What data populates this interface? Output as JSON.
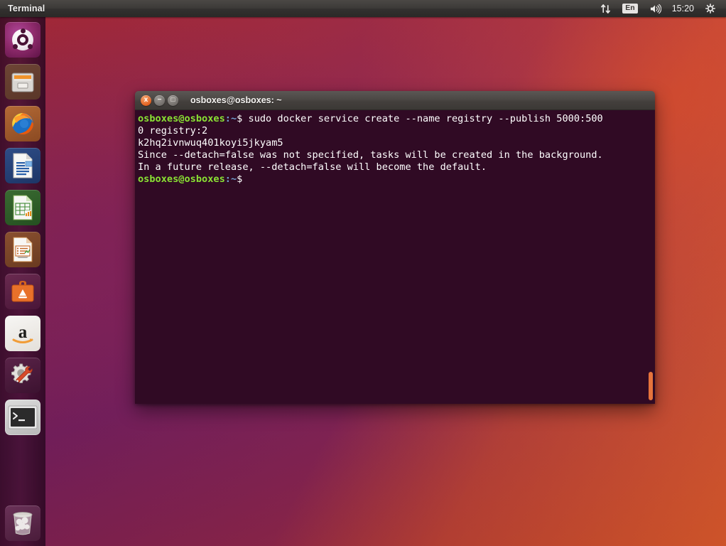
{
  "panel": {
    "app_title": "Terminal",
    "indicators": [
      {
        "name": "network-icon",
        "label": ""
      },
      {
        "name": "keyboard-layout-indicator",
        "label": "En"
      },
      {
        "name": "volume-icon",
        "label": ""
      },
      {
        "name": "clock",
        "label": "15:20"
      },
      {
        "name": "system-menu-icon",
        "label": ""
      }
    ],
    "clock": "15:20",
    "keyboard_layout": "En"
  },
  "launcher": {
    "items": [
      {
        "name": "ubuntu-dash",
        "label": "Ubuntu Dash Home",
        "running": false
      },
      {
        "name": "files",
        "label": "Files",
        "running": false
      },
      {
        "name": "firefox",
        "label": "Firefox Web Browser",
        "running": false
      },
      {
        "name": "libreoffice-writer",
        "label": "LibreOffice Writer",
        "running": false
      },
      {
        "name": "libreoffice-calc",
        "label": "LibreOffice Calc",
        "running": false
      },
      {
        "name": "libreoffice-impress",
        "label": "LibreOffice Impress",
        "running": false
      },
      {
        "name": "ubuntu-software",
        "label": "Ubuntu Software",
        "running": false
      },
      {
        "name": "amazon",
        "label": "Amazon",
        "running": false
      },
      {
        "name": "system-settings",
        "label": "System Settings",
        "running": false
      },
      {
        "name": "terminal",
        "label": "Terminal",
        "running": true
      },
      {
        "name": "trash",
        "label": "Trash",
        "running": false
      }
    ]
  },
  "terminal": {
    "title": "osboxes@osboxes: ~",
    "window_buttons": {
      "close": "x",
      "minimize": "−",
      "maximize": "□"
    },
    "prompt_user_host": "osboxes@osboxes",
    "prompt_path": ":~",
    "prompt_symbol": "$",
    "lines": [
      {
        "type": "prompt",
        "command": "sudo docker service create --name registry --publish 5000:500"
      },
      {
        "type": "output",
        "text": "0 registry:2"
      },
      {
        "type": "output",
        "text": "k2hq2ivnwuq401koyi5jkyam5"
      },
      {
        "type": "output",
        "text": "Since --detach=false was not specified, tasks will be created in the background."
      },
      {
        "type": "output",
        "text": "In a future release, --detach=false will become the default."
      },
      {
        "type": "prompt",
        "command": ""
      }
    ]
  },
  "colors": {
    "terminal_background": "#300a24",
    "prompt_green": "#8ae234",
    "prompt_blue": "#729fcf",
    "ubuntu_orange": "#dd4814",
    "ubuntu_purple": "#772953",
    "panel_background": "#3c3a38",
    "scrollbar_thumb": "#e6733c"
  }
}
